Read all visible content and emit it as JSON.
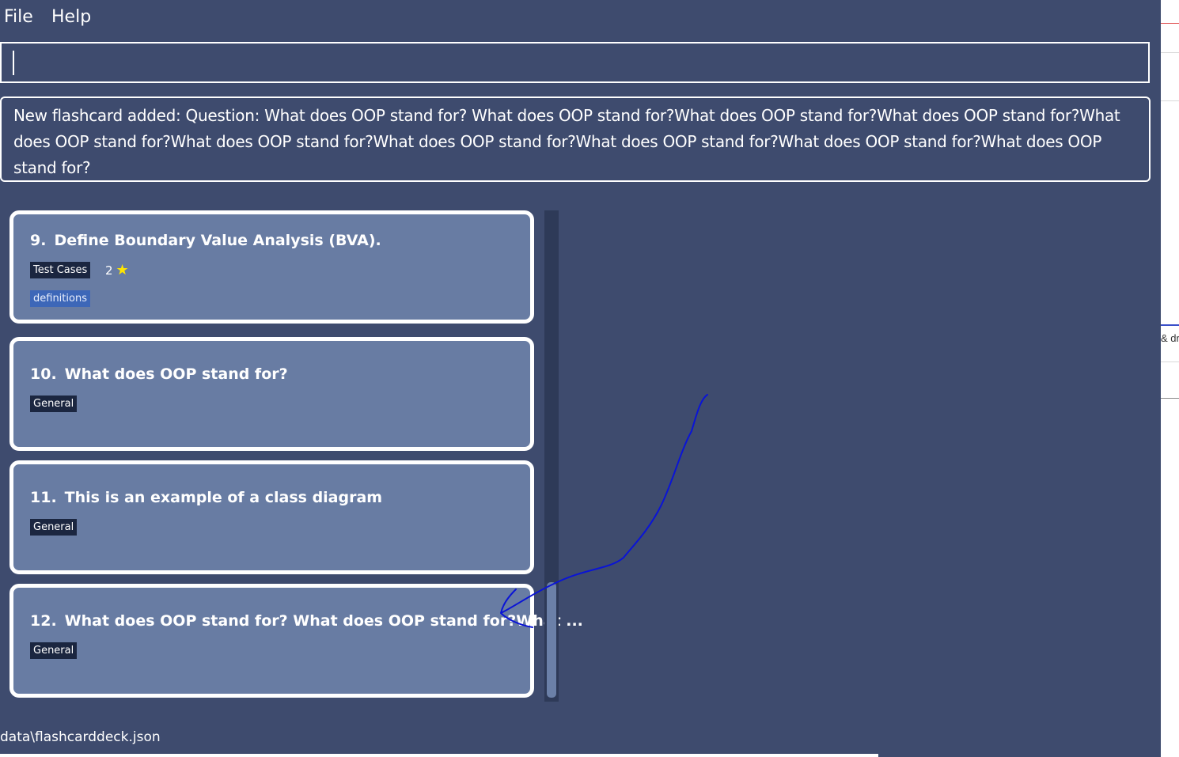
{
  "menu": {
    "file": "File",
    "help": "Help"
  },
  "command_box": {
    "value": ""
  },
  "result": {
    "text": "New flashcard added:  Question: What does OOP stand for? What does OOP stand for?What does OOP stand for?What does OOP stand for?What does OOP stand for?What does OOP stand for?What does OOP stand for?What does OOP stand for?What does OOP stand for?What does OOP stand for?"
  },
  "cards": [
    {
      "index": "9.",
      "question": "Define Boundary Value Analysis (BVA).",
      "tag": "Test Cases",
      "rating": "2",
      "category": "definitions"
    },
    {
      "index": "10.",
      "question": "What does OOP stand for?",
      "tag": "General"
    },
    {
      "index": "11.",
      "question": "This is an example of a class diagram",
      "tag": "General"
    },
    {
      "index": "12.",
      "question": "What does OOP stand for? What does OOP stand for?What ...",
      "tag": "General"
    }
  ],
  "status_bar": {
    "path": "data\\flashcarddeck.json"
  },
  "background_window": {
    "partial_text": "& dr"
  },
  "colors": {
    "app_background": "#3e4b6e",
    "card_background": "#687ca3",
    "tag_background": "#1b2640",
    "category_background": "#3d67b8",
    "star": "#ffe600",
    "annotation_ink": "#0a14d6"
  },
  "icons": {
    "rating": "star-icon"
  }
}
